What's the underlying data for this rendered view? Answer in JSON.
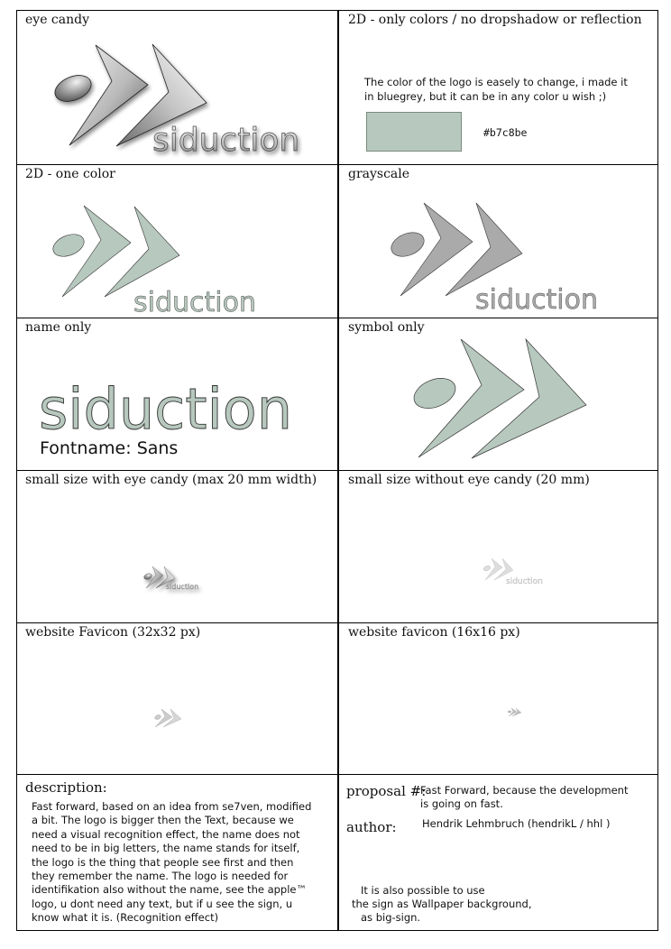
{
  "cells": {
    "eye_candy": {
      "label": "eye candy"
    },
    "colors": {
      "label": "2D - only colors / no dropshadow or reflection",
      "text": [
        "The color of the logo is easely to change, i made it",
        "in bluegrey, but it can be in any color u wish ;)"
      ],
      "swatch_color": "#b7c8be",
      "hex_label": "#b7c8be"
    },
    "one_color": {
      "label": "2D - one color"
    },
    "grayscale": {
      "label": "grayscale"
    },
    "name_only": {
      "label": "name only",
      "fontname": "Fontname: Sans"
    },
    "symbol_only": {
      "label": "symbol only"
    },
    "small_eye_candy": {
      "label": "small size with eye candy (max 20 mm width)"
    },
    "small_plain": {
      "label": "small size without eye candy (20 mm)"
    },
    "favicon_32": {
      "label": "website Favicon (32x32 px)"
    },
    "favicon_16": {
      "label": "website favicon (16x16 px)"
    },
    "description": {
      "label": "description:",
      "lines": [
        "Fast forward, based on an idea from se7ven, modified",
        "a bit. The logo is bigger then the Text, because we",
        "need a visual recognition effect, the name does not",
        "need to be in big letters, the name stands for itself,",
        "the logo is the thing that people see first and then",
        "they remember the name. The logo is needed for",
        "identifikation also without the name, see the apple™",
        "logo, u dont need any text, but if u see the sign, u",
        "know what it is. (Recognition effect)"
      ]
    },
    "proposal": {
      "proposal_label": "proposal #:",
      "proposal_lines": [
        "Fast Forward, because the  development",
        "is going on fast."
      ],
      "author_label": "author:",
      "author_value": "Hendrik Lehmbruch (hendrikL / hhl )",
      "note_lines": [
        "It is also possible to use",
        "the sign as Wallpaper background,",
        "as big-sign."
      ]
    }
  },
  "logo": {
    "wordmark": "siduction",
    "brand_color": "#b7c8be",
    "gray_color": "#aaaaaa"
  }
}
